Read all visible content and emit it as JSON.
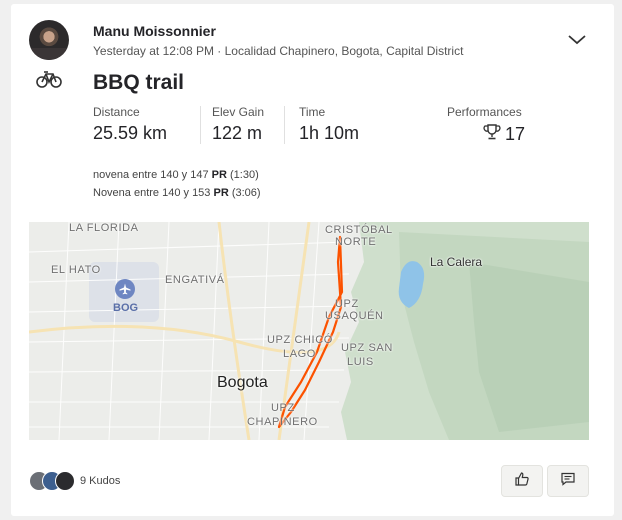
{
  "athlete": {
    "name": "Manu Moissonnier"
  },
  "activity": {
    "meta": "Yesterday at 12:08 PM · Localidad Chapinero, Bogota, Capital District",
    "title": "BBQ trail",
    "sport_icon": "bike-icon"
  },
  "stats": {
    "distance": {
      "label": "Distance",
      "value": "25.59 km"
    },
    "elevation": {
      "label": "Elev Gain",
      "value": "122 m"
    },
    "time": {
      "label": "Time",
      "value": "1h 10m"
    },
    "performances": {
      "label": "Performances",
      "value": "17",
      "icon": "trophy-icon"
    }
  },
  "segments": [
    {
      "name": "novena entre 140 y 147",
      "badge": "PR",
      "time": "(1:30)"
    },
    {
      "name": "Novena entre 140 y 153",
      "badge": "PR",
      "time": "(3:06)"
    }
  ],
  "map": {
    "labels": {
      "la_florida": "LA FLORIDA",
      "el_hato": "EL HATO",
      "engativa": "ENGATIVÁ",
      "cristobal": "CRISTÓBAL",
      "norte": "NORTE",
      "usaquen_a": "UPZ",
      "usaquen_b": "USAQUÉN",
      "chico_a": "UPZ CHICÓ",
      "chico_b": "LAGO",
      "san_luis_a": "UPZ SAN",
      "san_luis_b": "LUIS",
      "chapinero_a": "UPZ",
      "chapinero_b": "CHAPINERO",
      "la_calera": "La Calera",
      "bogota": "Bogota",
      "airport": "BOG"
    },
    "route_color": "#fc5200"
  },
  "kudos": {
    "count_label": "9 Kudos"
  },
  "actions": {
    "kudo": "thumbs-up-icon",
    "comment": "comment-icon"
  }
}
